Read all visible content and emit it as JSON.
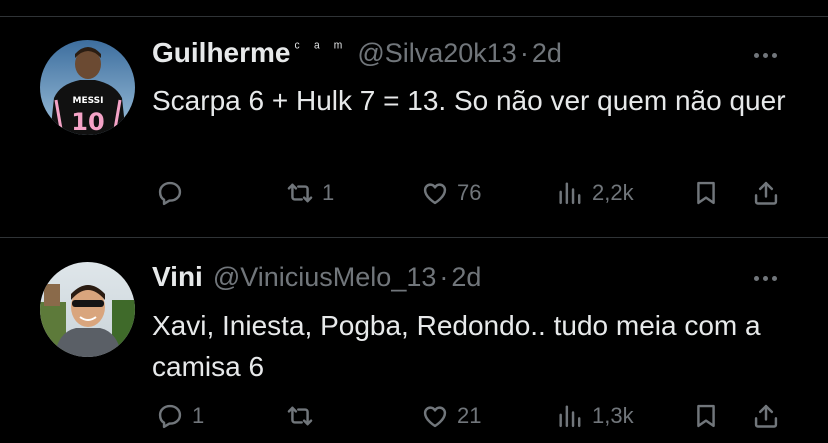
{
  "tweets": [
    {
      "display_name": "Guilherme",
      "name_suffix": "ᶜ ᵃ ᵐ",
      "handle": "@Silva20k13",
      "separator": "·",
      "time": "2d",
      "text": "Scarpa 6 + Hulk 7 = 13. So não ver quem não quer",
      "avatar_jersey_name": "MESSI",
      "avatar_jersey_number": "10",
      "replies": "",
      "retweets": "1",
      "likes": "76",
      "views": "2,2k"
    },
    {
      "display_name": "Vini",
      "handle": "@ViniciusMelo_13",
      "separator": "·",
      "time": "2d",
      "text": "Xavi, Iniesta, Pogba, Redondo.. tudo meia com a camisa 6",
      "replies": "1",
      "retweets": "",
      "likes": "21",
      "views": "1,3k"
    }
  ],
  "colors": {
    "background": "#000000",
    "text_primary": "#e7e9ea",
    "text_secondary": "#71767b",
    "divider": "#2f3336",
    "jersey_pink": "#f5a3c7"
  },
  "icons": [
    "reply-icon",
    "retweet-icon",
    "like-icon",
    "views-icon",
    "bookmark-icon",
    "share-icon",
    "more-icon"
  ]
}
